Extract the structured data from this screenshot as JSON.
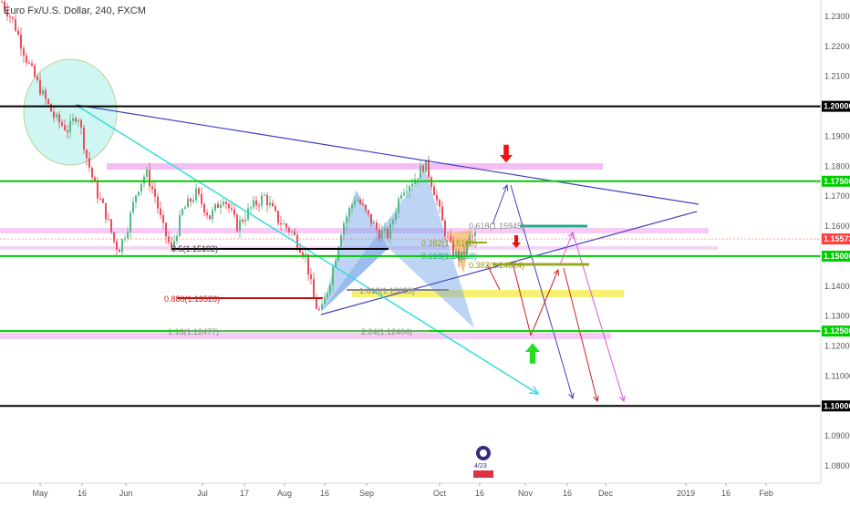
{
  "title": "Euro Fx/U.S. Dollar, 240, FXCM",
  "chart_data": {
    "type": "candlestick",
    "symbol": "Euro Fx/U.S. Dollar",
    "interval": "240",
    "source": "FXCM",
    "ylim": [
      1.075,
      1.237
    ],
    "y_ticks": [
      "1.23000",
      "1.22000",
      "1.21000",
      "1.20000",
      "1.19000",
      "1.18000",
      "1.17500",
      "1.17000",
      "1.16000",
      "1.15573",
      "1.15000",
      "1.14000",
      "1.13000",
      "1.12500",
      "1.12000",
      "1.11000",
      "1.10000",
      "1.09000",
      "1.08000"
    ],
    "x_ticks": [
      "May",
      "16",
      "Jun",
      "Jul",
      "17",
      "Aug",
      "16",
      "Sep",
      "Oct",
      "16",
      "Nov",
      "16",
      "Dec",
      "2019",
      "16",
      "Feb"
    ],
    "current_price": 1.15573,
    "horizontal_levels": [
      {
        "price": 1.2,
        "color": "#000000",
        "label": "1.20000"
      },
      {
        "price": 1.175,
        "color": "#00cc00",
        "label": "1.17500"
      },
      {
        "price": 1.15,
        "color": "#00cc00",
        "label": "1.15000"
      },
      {
        "price": 1.125,
        "color": "#00cc00",
        "label": "1.12500"
      },
      {
        "price": 1.1,
        "color": "#000000",
        "label": "1.10000"
      }
    ],
    "fib_labels": [
      {
        "text": "0.5(1.15192)",
        "color": "#333333"
      },
      {
        "text": "0.886(1.13528)",
        "color": "#cc2222"
      },
      {
        "text": "1.13(1.12477)",
        "color": "#888888"
      },
      {
        "text": "1.618(1.13833)",
        "color": "#888888"
      },
      {
        "text": "2.24(1.12404)",
        "color": "#888888"
      },
      {
        "text": "0.618(1.15945)",
        "color": "#888888"
      },
      {
        "text": "0.382(1.15106)",
        "color": "#999900"
      },
      {
        "text": "0.618(1.14858)",
        "color": "#22aa88"
      },
      {
        "text": "0.382(1.14824)",
        "color": "#999900"
      }
    ],
    "grid": false,
    "watermark": "4/23"
  }
}
